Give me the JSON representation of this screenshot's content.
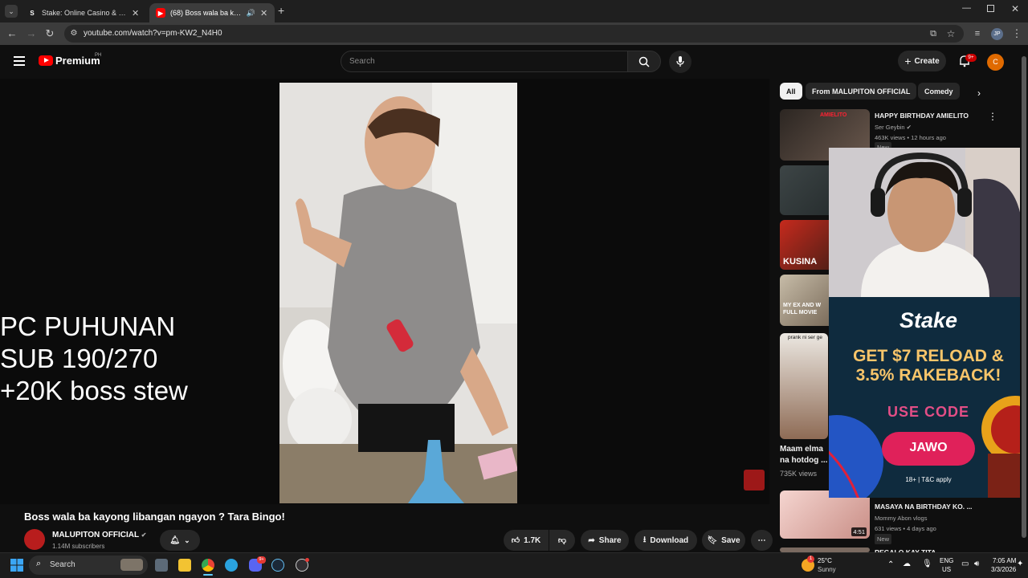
{
  "browser": {
    "tabs": [
      {
        "title": "Stake: Online Casino & Sports B",
        "favicon": "S"
      },
      {
        "title": "(68) Boss wala ba kayong lib",
        "favicon": "▶"
      }
    ],
    "url": "youtube.com/watch?v=pm-KW2_N4H0",
    "profile_initials": "JP"
  },
  "youtube": {
    "logo_label": "Premium",
    "region": "PH",
    "search_placeholder": "Search",
    "create_label": "Create",
    "notif_badge": "9+",
    "avatar_letter": "C"
  },
  "video": {
    "overlay_lines": [
      "PC PUHUNAN",
      "SUB 190/270",
      "+20K boss stew"
    ],
    "title": "Boss wala ba kayong libangan ngayon ? Tara Bingo!",
    "channel": "MALUPITON OFFICIAL",
    "subscribers": "1.14M subscribers",
    "likes": "1.7K",
    "share_label": "Share",
    "download_label": "Download",
    "save_label": "Save",
    "bingo_ball": "B"
  },
  "chips": [
    "All",
    "From MALUPITON OFFICIAL",
    "Comedy"
  ],
  "recommendations": [
    {
      "title": "HAPPY BIRTHDAY AMIELITO",
      "channel": "Ser Geybin",
      "meta": "463K views • 12 hours ago",
      "badge": "New",
      "thumb_text": "AMIELITO"
    },
    {
      "title": "",
      "channel": "",
      "meta": "",
      "badge": "",
      "thumb_text": ""
    },
    {
      "title": "",
      "channel": "",
      "meta": "",
      "badge": "",
      "thumb_text": "KUSINA"
    },
    {
      "title": "",
      "channel": "",
      "meta": "",
      "badge": "",
      "thumb_text": "MY EX AND W FULL MOVIE"
    },
    {
      "title": "Maam elma na hotdog ...",
      "channel": "",
      "meta": "735K views",
      "badge": "",
      "thumb_text": "prank ni ser ge"
    },
    {
      "title": "MASAYA NA BIRTHDAY KO. ...",
      "channel": "Mommy Abon vlogs",
      "meta": "631 views • 4 days ago",
      "badge": "New",
      "thumb_text": "",
      "duration": "4:51"
    },
    {
      "title": "REGALO KAY TITA",
      "channel": "",
      "meta": "",
      "badge": "",
      "thumb_text": ""
    }
  ],
  "ad": {
    "brand": "Stake",
    "headline_1": "GET $7 RELOAD &",
    "headline_2": "3.5% RAKEBACK!",
    "use_code": "USE CODE",
    "code": "JAWO",
    "disclaimer": "18+ | T&C apply"
  },
  "taskbar": {
    "search_label": "Search",
    "weather_temp": "25°C",
    "weather_desc": "Sunny",
    "lang_top": "ENG",
    "lang_bottom": "US",
    "time": "7:05 AM",
    "date": "3/3/2026",
    "weather_badge": "1",
    "discord_badge": "9+"
  },
  "colors": {
    "yt_red": "#ff0000",
    "stake_green": "#1475e1",
    "code_button": "#e0215a"
  }
}
